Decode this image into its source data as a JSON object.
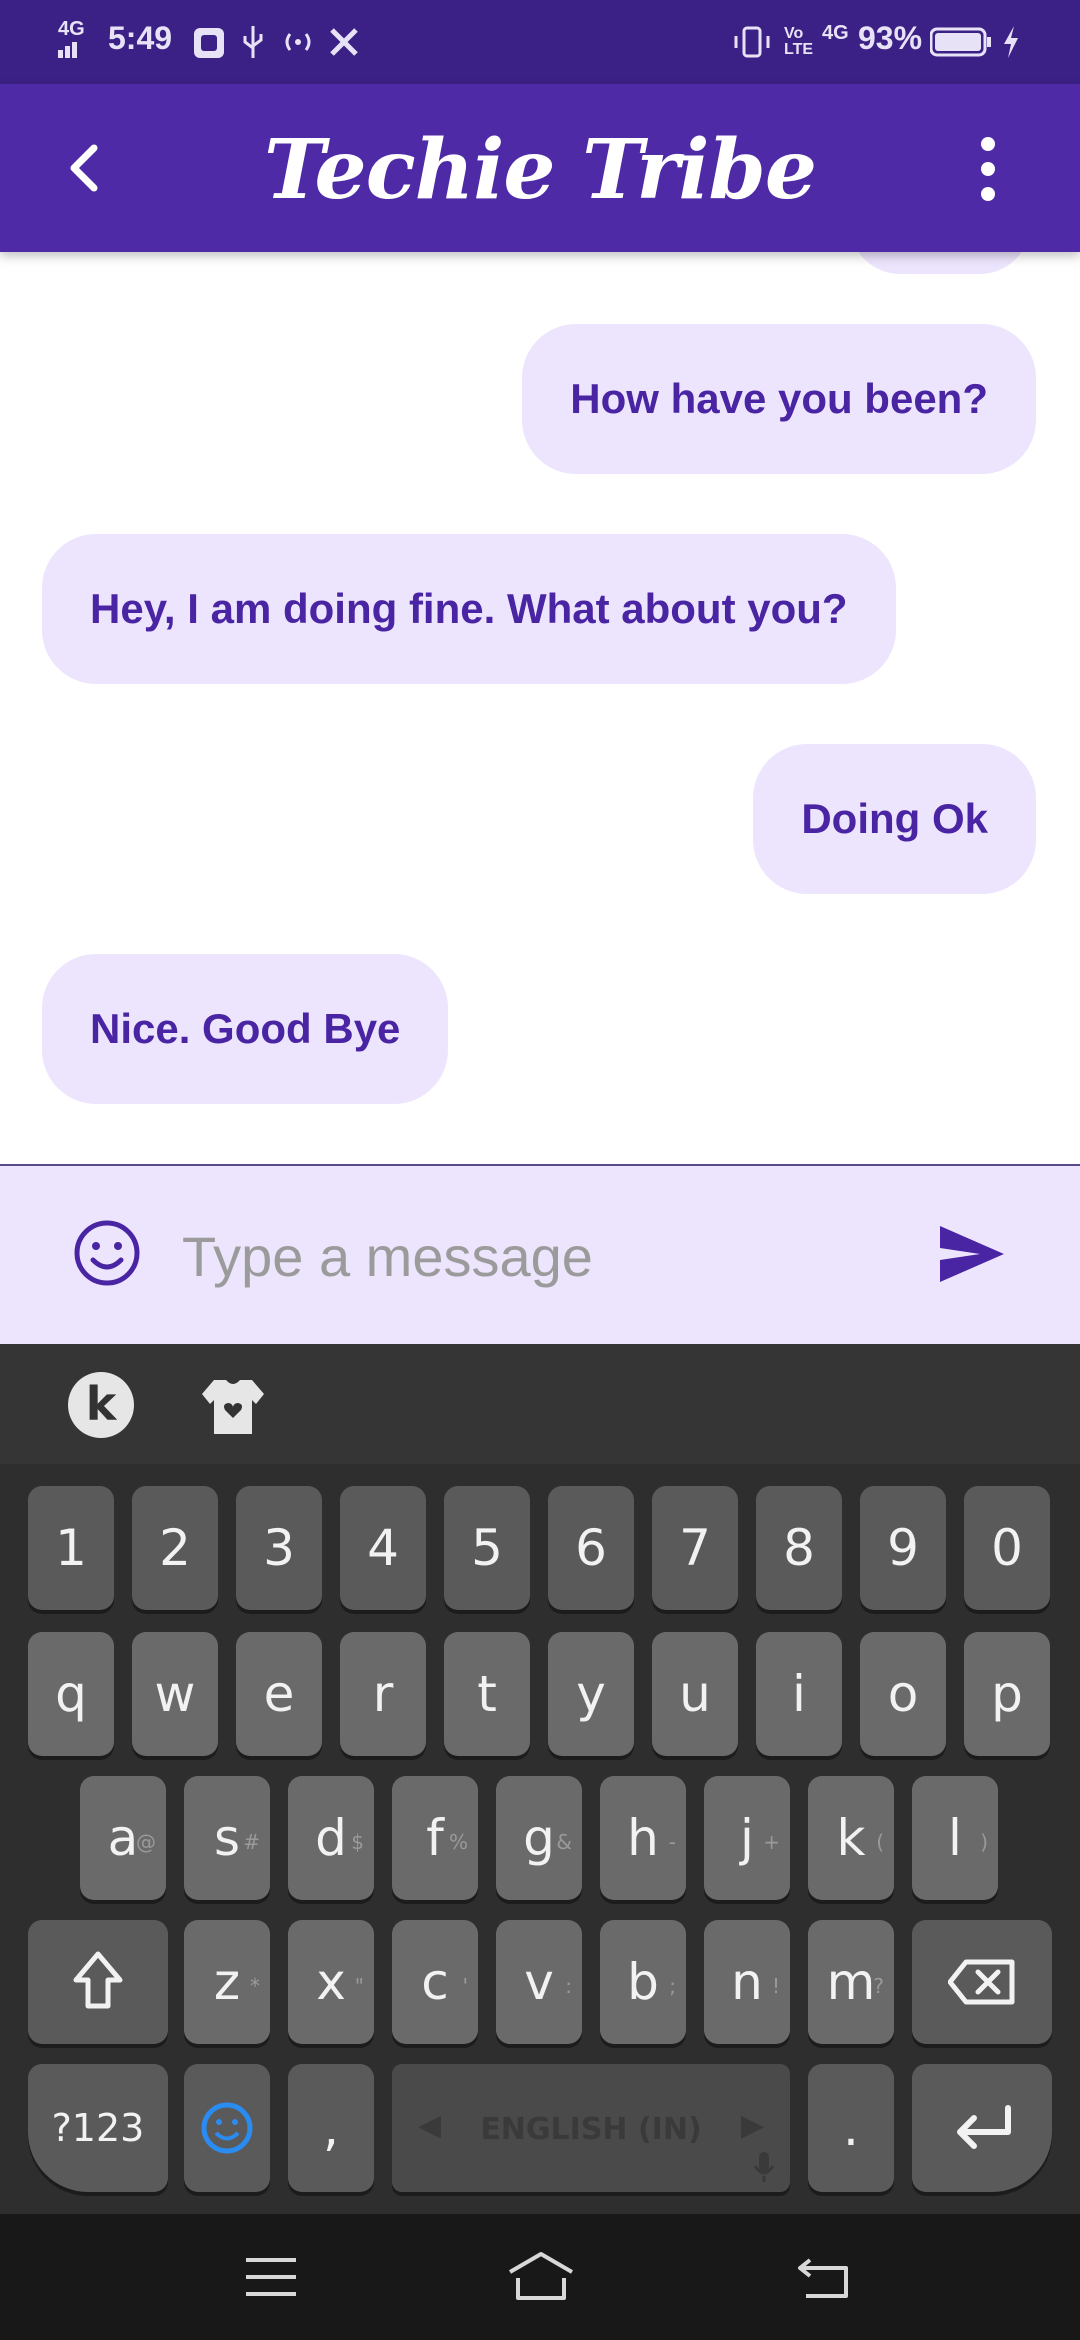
{
  "status_bar": {
    "time": "5:49",
    "network_left": "4G",
    "battery": "93%",
    "volte": "Vo LTE",
    "network_right": "4G"
  },
  "app_bar": {
    "title": "Techie Tribe"
  },
  "messages": [
    {
      "side": "outgoing",
      "text": "How have you been?"
    },
    {
      "side": "incoming",
      "text": "Hey, I am doing fine. What about you?"
    },
    {
      "side": "outgoing",
      "text": "Doing Ok"
    },
    {
      "side": "incoming",
      "text": "Nice. Good Bye"
    }
  ],
  "composer": {
    "placeholder": "Type a message"
  },
  "keyboard": {
    "toolbar": [
      "k",
      "shirt-heart-icon"
    ],
    "number_row": [
      "1",
      "2",
      "3",
      "4",
      "5",
      "6",
      "7",
      "8",
      "9",
      "0"
    ],
    "row1": [
      "q",
      "w",
      "e",
      "r",
      "t",
      "y",
      "u",
      "i",
      "o",
      "p"
    ],
    "row2": [
      "a",
      "s",
      "d",
      "f",
      "g",
      "h",
      "j",
      "k",
      "l"
    ],
    "row2_hints": [
      "@",
      "#",
      "$",
      "%",
      "&",
      "-",
      "+",
      "(",
      ")"
    ],
    "row3": [
      "z",
      "x",
      "c",
      "v",
      "b",
      "n",
      "m"
    ],
    "row3_hints": [
      "*",
      "\"",
      "'",
      ":",
      ";",
      "!",
      "?"
    ],
    "symbols_key": "?123",
    "comma_key": ",",
    "period_key": ".",
    "space_label": "ENGLISH (IN)"
  },
  "colors": {
    "primary": "#4f2aa6",
    "status_bar": "#3b2186",
    "bubble": "#ede5fd",
    "bubble_text": "#4a25a3"
  }
}
